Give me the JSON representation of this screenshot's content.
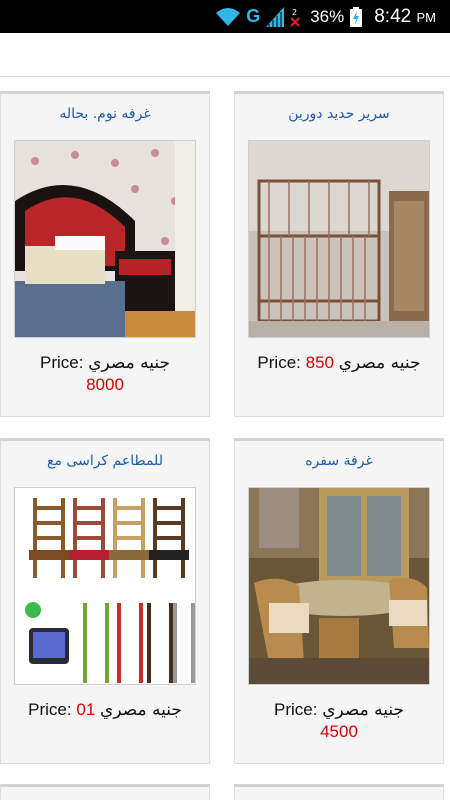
{
  "status_bar": {
    "network_type": "G",
    "battery_percent": "36%",
    "time": "8:42",
    "ampm": "PM",
    "icons": [
      "wifi-icon",
      "signal-icon",
      "no-sim-icon",
      "battery-charging-icon"
    ]
  },
  "listings": [
    {
      "title": "سرير حديد دورين",
      "price_label": "Price:",
      "price_value": "850",
      "currency": "جنيه مصري",
      "image": "metal-bunk-bed-photo"
    },
    {
      "title": "غرفه نوم. بحاله",
      "price_label": "Price:",
      "price_value": "8000",
      "currency": "جنيه مصري",
      "image": "bedroom-set-photo"
    },
    {
      "title": "غرفة سفره",
      "price_label": "Price:",
      "price_value": "4500",
      "currency": "جنيه مصري",
      "image": "dining-room-set-photo"
    },
    {
      "title": "للمطاعم كراسى مع",
      "price_label": "Price:",
      "price_value": "01",
      "currency": "جنيه مصري",
      "image": "restaurant-chairs-photo"
    }
  ],
  "colors": {
    "title": "#1e5ba8",
    "price_value": "#e00000",
    "card_bg": "#f5f5f5",
    "network": "#31b6e7"
  }
}
